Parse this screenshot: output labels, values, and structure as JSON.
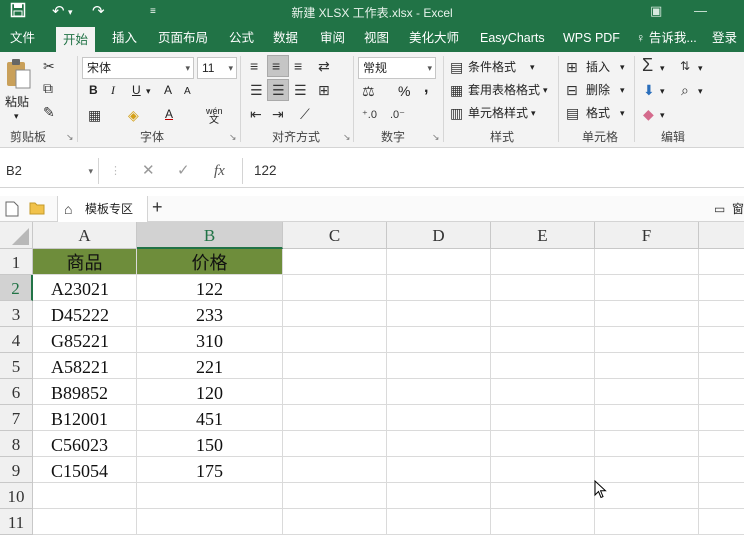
{
  "app": {
    "title": "新建 XLSX 工作表.xlsx - Excel",
    "accent_color": "#217346",
    "qa_icons": [
      "save-icon",
      "undo-icon",
      "redo-icon",
      "customize-icon"
    ]
  },
  "tabs": [
    "文件",
    "开始",
    "插入",
    "页面布局",
    "公式",
    "数据",
    "审阅",
    "视图",
    "美化大师",
    "EasyCharts",
    "WPS PDF"
  ],
  "active_tab": "开始",
  "tell_me": "告诉我...",
  "login": "登录",
  "ribbon": {
    "clipboard": {
      "paste": "粘贴",
      "label": "剪贴板"
    },
    "font": {
      "name": "宋体",
      "size": "11",
      "label": "字体",
      "bold": "B",
      "italic": "I",
      "underline": "U",
      "grow": "A",
      "shrink": "A",
      "font_color": "A",
      "wen": "wén",
      "wen2": "文"
    },
    "alignment": {
      "label": "对齐方式"
    },
    "number": {
      "format": "常规",
      "label": "数字",
      "percent": "%",
      "comma": ","
    },
    "styles": {
      "conditional": "条件格式",
      "table": "套用表格格式",
      "cell": "单元格样式",
      "label": "样式"
    },
    "cells": {
      "insert": "插入",
      "delete": "删除",
      "format": "格式",
      "label": "单元格"
    },
    "editing": {
      "label": "编辑"
    }
  },
  "formula_bar": {
    "name_box": "B2",
    "cancel": "✕",
    "enter": "✓",
    "fx": "fx",
    "value": "122"
  },
  "doc_tabs": {
    "template_tab": "模板专区",
    "add": "+",
    "window_label": "窗"
  },
  "sheet": {
    "columns": [
      "A",
      "B",
      "C",
      "D",
      "E",
      "F"
    ],
    "rows": [
      "1",
      "2",
      "3",
      "4",
      "5",
      "6",
      "7",
      "8",
      "9",
      "10",
      "11"
    ],
    "header": {
      "a": "商品",
      "b": "价格",
      "fill_color": "#6e8d3b"
    },
    "data": [
      {
        "code": "A23021",
        "price": "122"
      },
      {
        "code": "D45222",
        "price": "233"
      },
      {
        "code": "G85221",
        "price": "310"
      },
      {
        "code": "A58221",
        "price": "221"
      },
      {
        "code": "B89852",
        "price": "120"
      },
      {
        "code": "B12001",
        "price": "451"
      },
      {
        "code": "C56023",
        "price": "150"
      },
      {
        "code": "C15054",
        "price": "175"
      }
    ],
    "selected_cell": "B2"
  }
}
